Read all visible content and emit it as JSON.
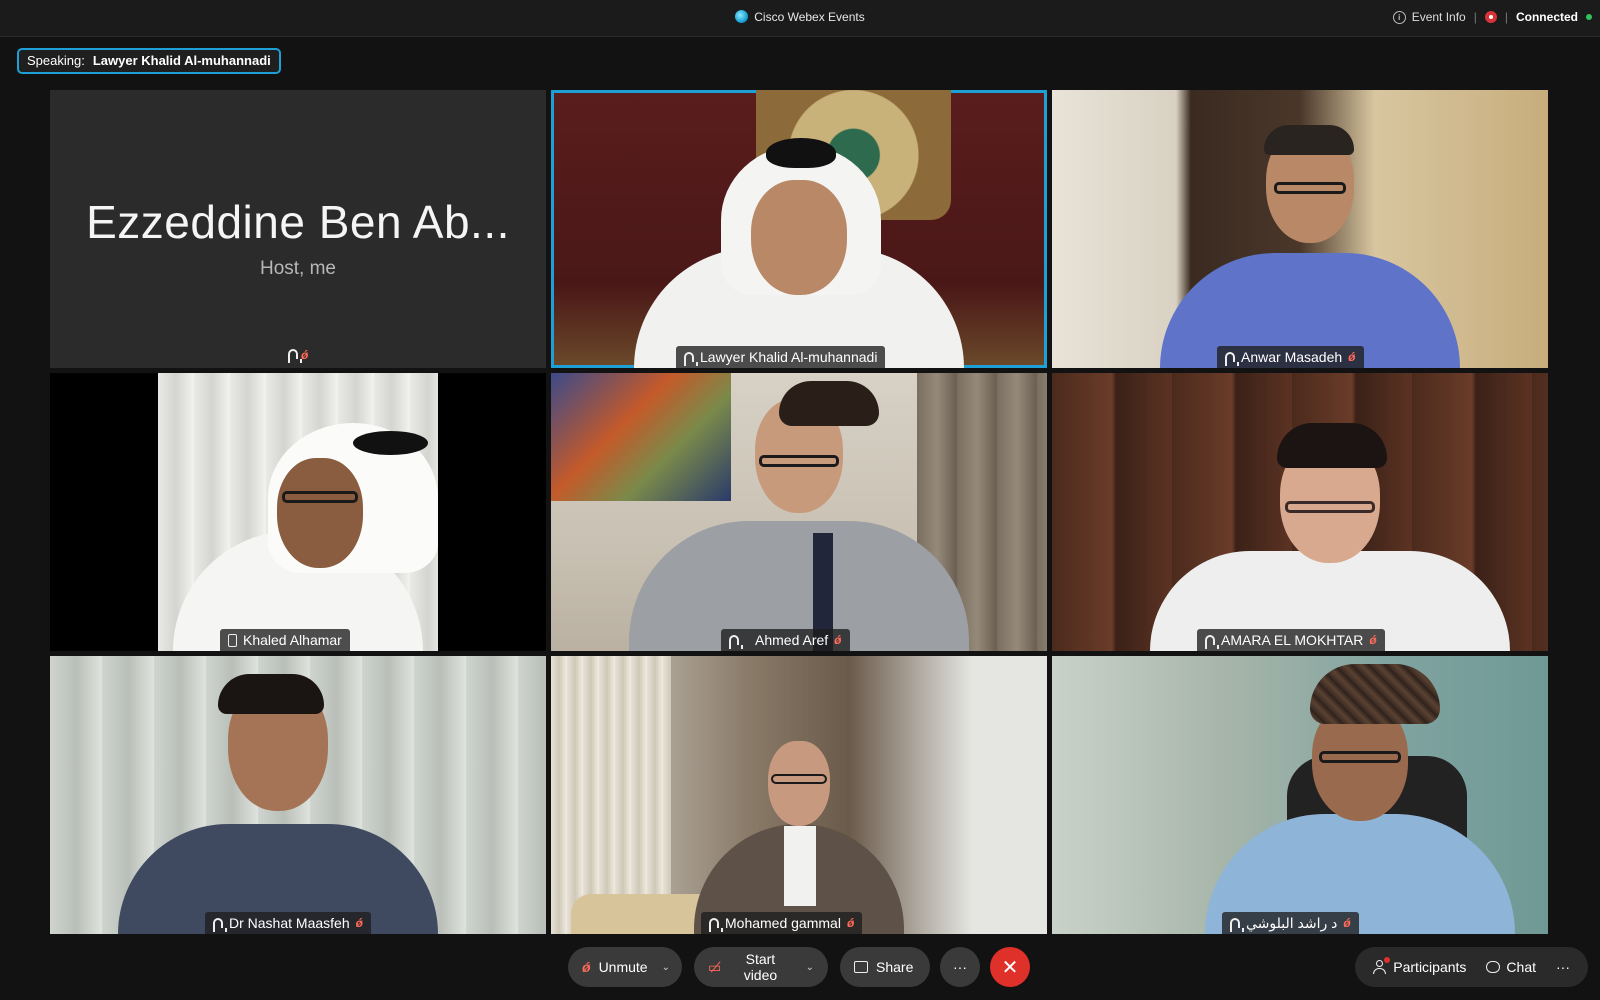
{
  "titlebar": {
    "app_title": "Cisco Webex Events",
    "event_info": "Event Info",
    "separator": "|",
    "connection_status": "Connected"
  },
  "speaking": {
    "label": "Speaking:",
    "name": "Lawyer Khalid Al-muhannadi"
  },
  "host_tile": {
    "name": "Ezzeddine Ben Ab...",
    "subtitle": "Host, me"
  },
  "participants": [
    {
      "name": "Lawyer Khalid Al-muhannadi",
      "icon": "headset-icon",
      "muted": false,
      "active_speaker": true
    },
    {
      "name": "Anwar Masadeh",
      "icon": "headset-icon",
      "muted": true
    },
    {
      "name": "Khaled Alhamar",
      "icon": "phone-icon",
      "muted": false
    },
    {
      "name": "Ahmed Aref",
      "icon": "headset-icon",
      "muted": true
    },
    {
      "name": "AMARA EL MOKHTAR",
      "icon": "headset-icon",
      "muted": true
    },
    {
      "name": "Dr Nashat Maasfeh",
      "icon": "headset-icon",
      "muted": true
    },
    {
      "name": "Mohamed gammal",
      "icon": "headset-icon",
      "muted": true
    },
    {
      "name": "د راشد البلوشي",
      "icon": "headset-icon",
      "muted": true
    }
  ],
  "controls": {
    "unmute": "Unmute",
    "start_video": "Start video",
    "share": "Share",
    "more": "···",
    "end": "✕",
    "participants": "Participants",
    "chat": "Chat",
    "overflow": "···"
  },
  "colors": {
    "accent": "#1e9fd6",
    "end_call": "#e0302a",
    "connected": "#2fc45a",
    "muted": "#ff6a5a"
  }
}
